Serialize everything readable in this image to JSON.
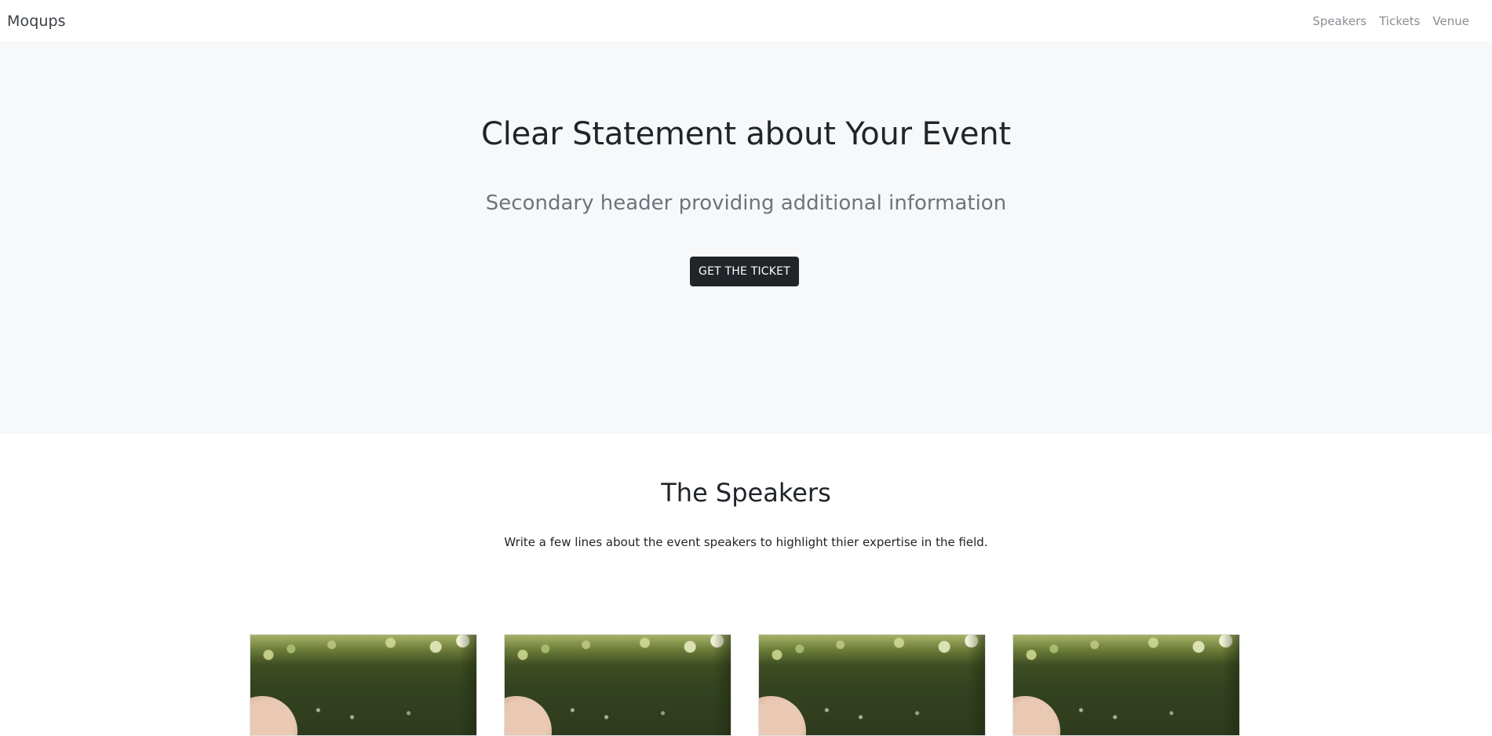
{
  "navbar": {
    "brand": "Moqups",
    "links": [
      {
        "label": "Speakers"
      },
      {
        "label": "Tickets"
      },
      {
        "label": "Venue"
      }
    ]
  },
  "hero": {
    "title": "Clear Statement about Your Event",
    "subtitle": "Secondary header providing additional information",
    "cta_label": "GET THE TICKET",
    "background_color": "#f7f8f9",
    "button_color": "#212529"
  },
  "speakers": {
    "title": "The Speakers",
    "description": "Write a few lines about the event speakers to highlight thier expertise in the field.",
    "cards": [
      {
        "image": "speaker-photo"
      },
      {
        "image": "speaker-photo"
      },
      {
        "image": "speaker-photo"
      },
      {
        "image": "speaker-photo"
      }
    ]
  }
}
